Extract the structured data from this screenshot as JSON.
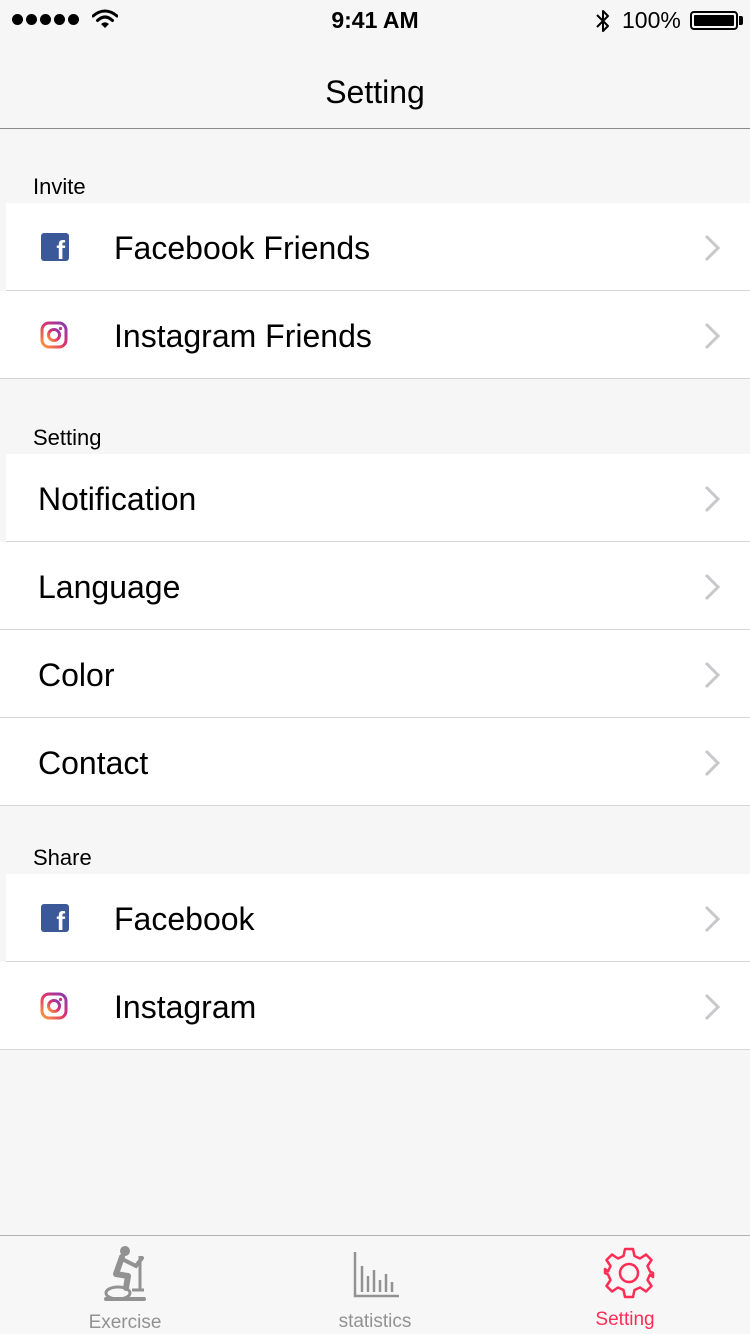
{
  "status_bar": {
    "time": "9:41 AM",
    "battery_percent": "100%",
    "battery_level": 1.0,
    "icons": [
      "signal-dots-icon",
      "wifi-icon",
      "bluetooth-icon",
      "battery-icon"
    ]
  },
  "nav": {
    "title": "Setting"
  },
  "sections": {
    "invite": {
      "header": "Invite",
      "items": [
        {
          "label": "Facebook Friends",
          "icon": "facebook-icon"
        },
        {
          "label": "Instagram Friends",
          "icon": "instagram-icon"
        }
      ]
    },
    "setting": {
      "header": "Setting",
      "items": [
        {
          "label": "Notification"
        },
        {
          "label": "Language"
        },
        {
          "label": "Color"
        },
        {
          "label": "Contact"
        }
      ]
    },
    "share": {
      "header": "Share",
      "items": [
        {
          "label": "Facebook",
          "icon": "facebook-icon"
        },
        {
          "label": "Instagram",
          "icon": "instagram-icon"
        }
      ]
    }
  },
  "tab_bar": {
    "tabs": [
      {
        "label": "Exercise",
        "icon": "exercise-bike-icon",
        "active": false
      },
      {
        "label": "statistics",
        "icon": "bar-chart-icon",
        "active": false
      },
      {
        "label": "Setting",
        "icon": "gear-icon",
        "active": true
      }
    ]
  },
  "colors": {
    "accent": "#ff2d55",
    "inactive_tab": "#929292",
    "facebook": "#3b5998",
    "chevron": "#c7c7cc"
  }
}
